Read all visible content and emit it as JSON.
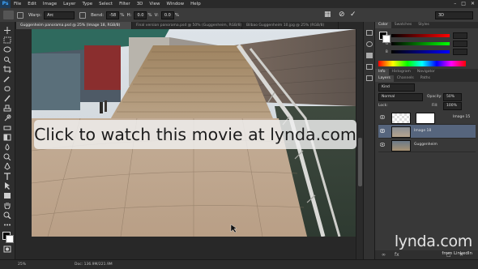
{
  "app": {
    "logo_text": "Ps"
  },
  "menu": [
    "File",
    "Edit",
    "Image",
    "Layer",
    "Type",
    "Select",
    "Filter",
    "3D",
    "View",
    "Window",
    "Help"
  ],
  "options_bar": {
    "warp_label": "Warp:",
    "warp_value": "Arc",
    "bend_label": "Bend:",
    "bend_value": "-58",
    "percent": "%",
    "h_label": "H:",
    "h_value": "0.0",
    "v_label": "V:",
    "v_value": "0.0",
    "workspace": "3D",
    "cancel_icon": "cancel-icon",
    "commit_icon": "checkmark-icon"
  },
  "tabs": [
    "Guggenheim panorama.psd @ 25% (Image 18, RGB/8)",
    "Final version panorama.psd @ 50% (Guggenheim, RGB/8)",
    "Bilbao Guggenheim 10.jpg @ 25% (RGB/8)"
  ],
  "color_panel": {
    "tabs": [
      "Color",
      "Swatches",
      "Styles"
    ]
  },
  "adjust_panel": {
    "tabs": [
      "Info",
      "Histogram",
      "Navigator"
    ]
  },
  "layers_panel": {
    "tabs": [
      "Layers",
      "Channels",
      "Paths"
    ],
    "kind": "Kind",
    "blend_mode": "Normal",
    "opacity_label": "Opacity:",
    "opacity_value": "50%",
    "lock_label": "Lock:",
    "fill_label": "Fill:",
    "fill_value": "100%",
    "layers": [
      {
        "name": "Image 15",
        "selected": false
      },
      {
        "name": "Image 18",
        "selected": true
      },
      {
        "name": "Guggenheim",
        "selected": false
      }
    ]
  },
  "status": {
    "zoom": "25%",
    "doc": "Doc: 136.9M/221.9M"
  },
  "overlay": {
    "text": "Click to watch this movie at lynda.com"
  },
  "watermark": {
    "brand": "lynda.com",
    "sub": "from LinkedIn"
  }
}
